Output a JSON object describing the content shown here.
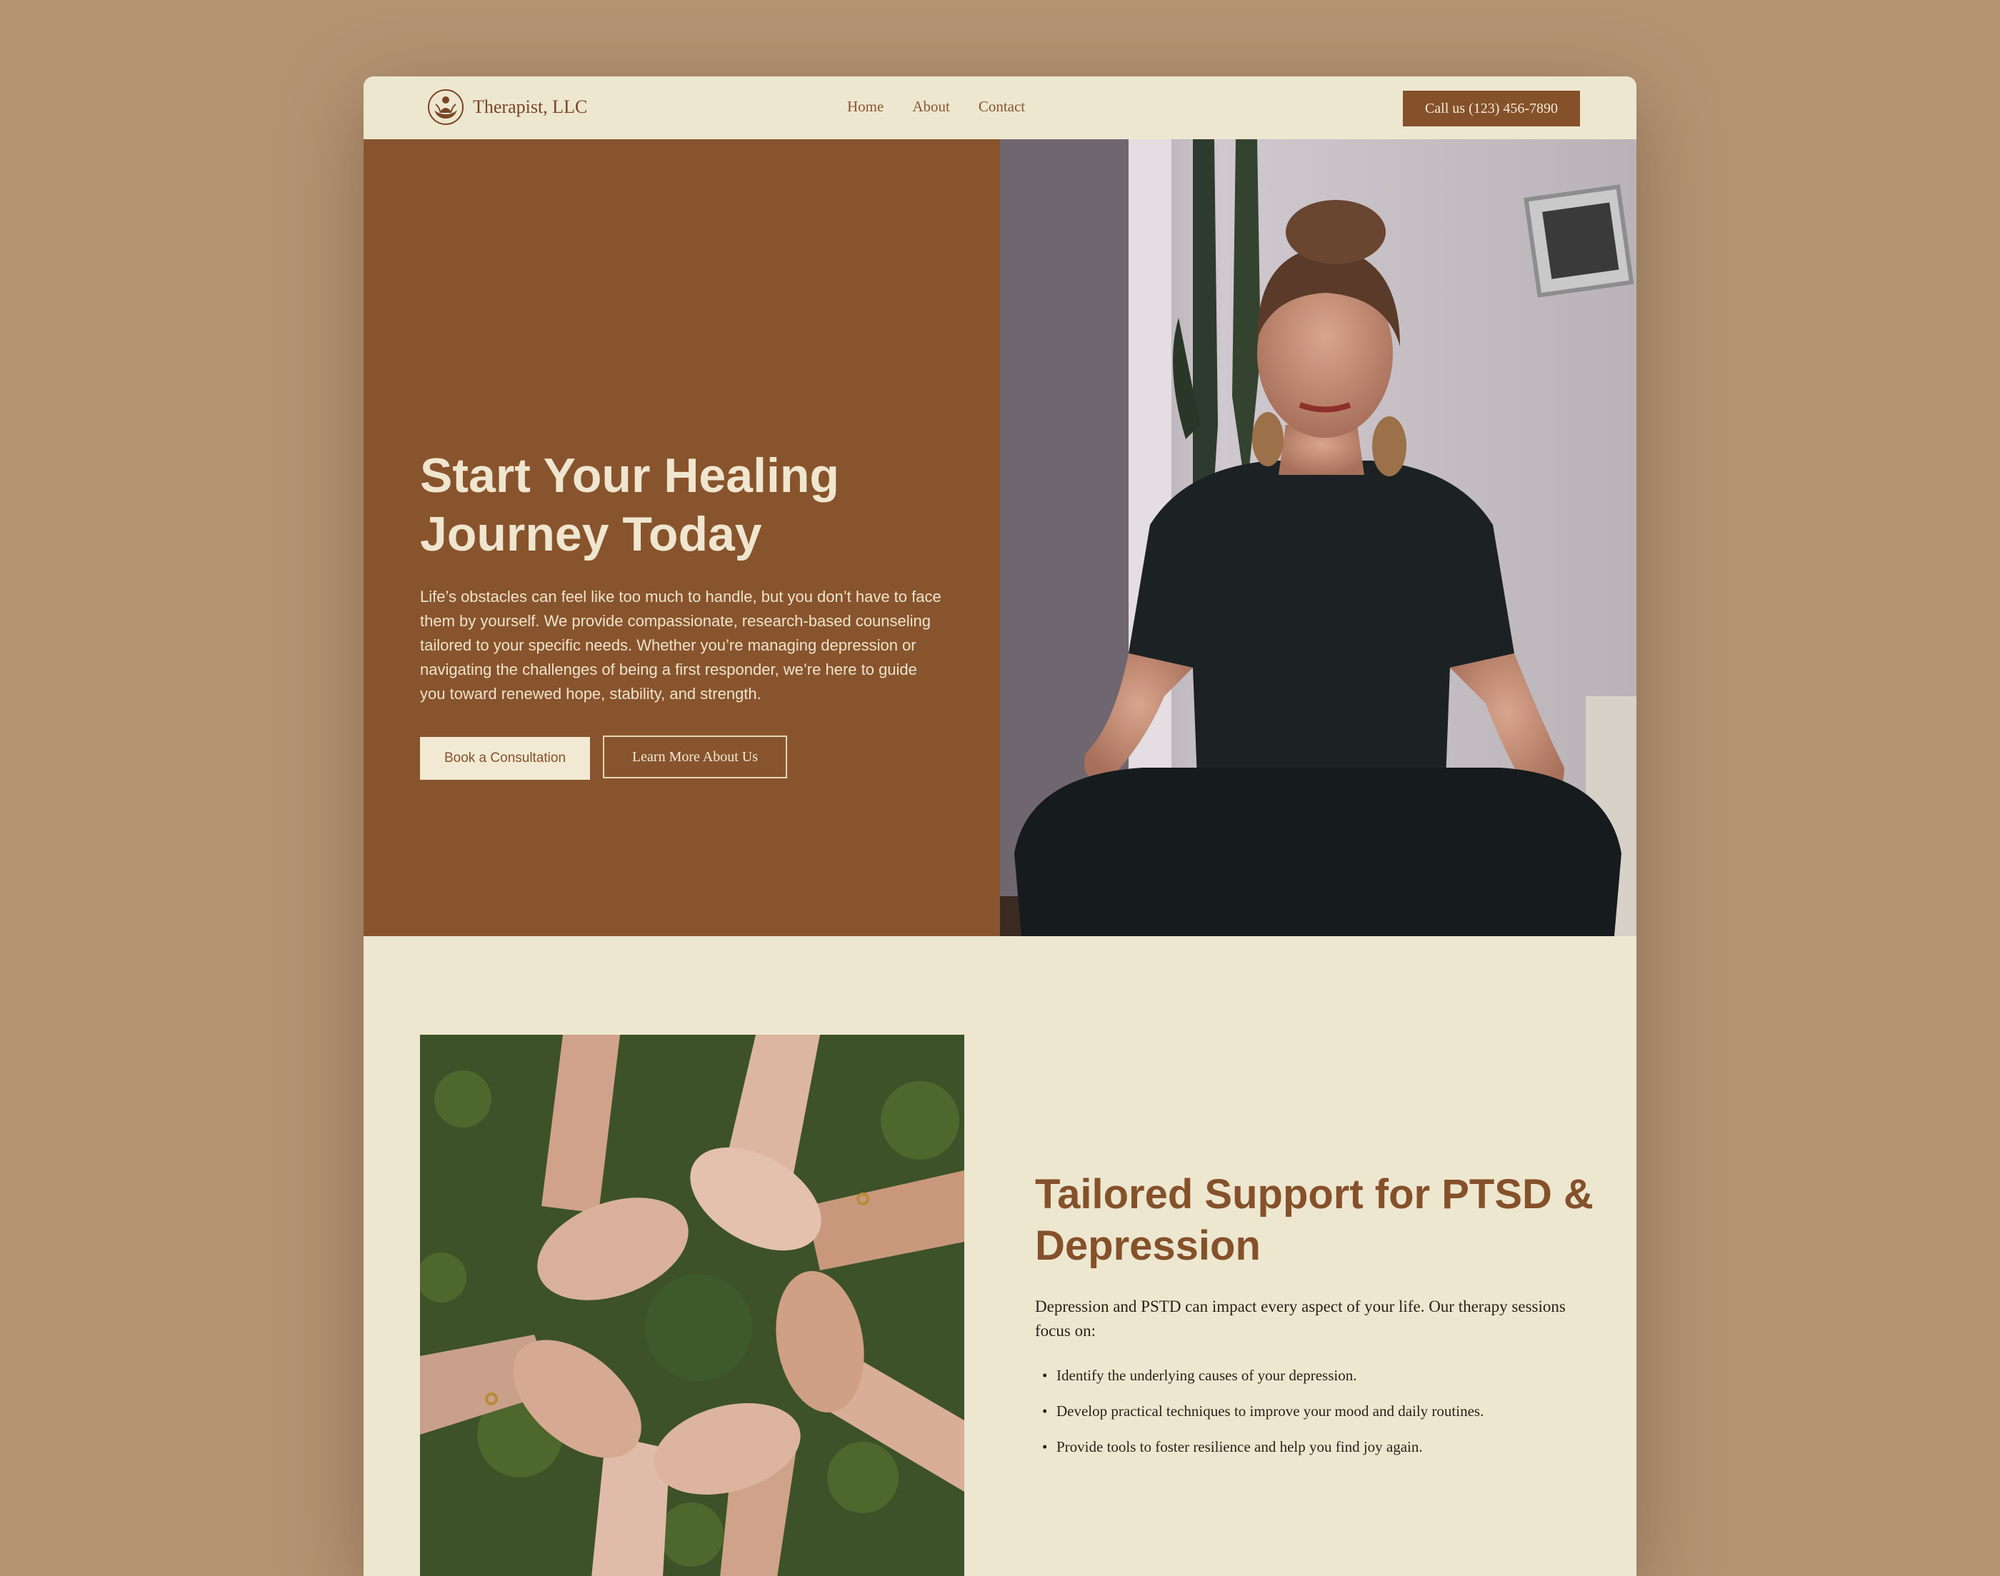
{
  "header": {
    "brand": "Therapist, LLC",
    "logo_icon": "lotus-meditation-icon",
    "nav": [
      {
        "label": "Home"
      },
      {
        "label": "About"
      },
      {
        "label": "Contact"
      }
    ],
    "call_button": "Call us (123) 456-7890"
  },
  "hero": {
    "title": "Start Your Healing Journey Today",
    "text": "Life’s obstacles can feel like too much to handle, but you don’t have to face them by yourself. We provide compassionate, research-based counseling tailored to your specific needs. Whether you’re managing depression or navigating the challenges of being a first responder, we’re here to guide you toward renewed hope, stability, and strength.",
    "primary_button": "Book a Consultation",
    "secondary_button": "Learn More About Us",
    "image_subject": "woman-meditating-photo"
  },
  "support": {
    "title": "Tailored Support for PTSD & Depression",
    "intro": "Depression and PSTD can impact every aspect of your life. Our therapy sessions focus on:",
    "items": [
      "Identify the underlying causes of your depression.",
      "Develop practical techniques to improve your mood and daily routines.",
      "Provide tools to foster resilience and help you find joy again."
    ],
    "image_subject": "joined-hands-circle-photo"
  },
  "colors": {
    "background": "#b59474",
    "page": "#ede7d0",
    "brand_brown": "#88542d",
    "cream": "#f1e9d3"
  }
}
